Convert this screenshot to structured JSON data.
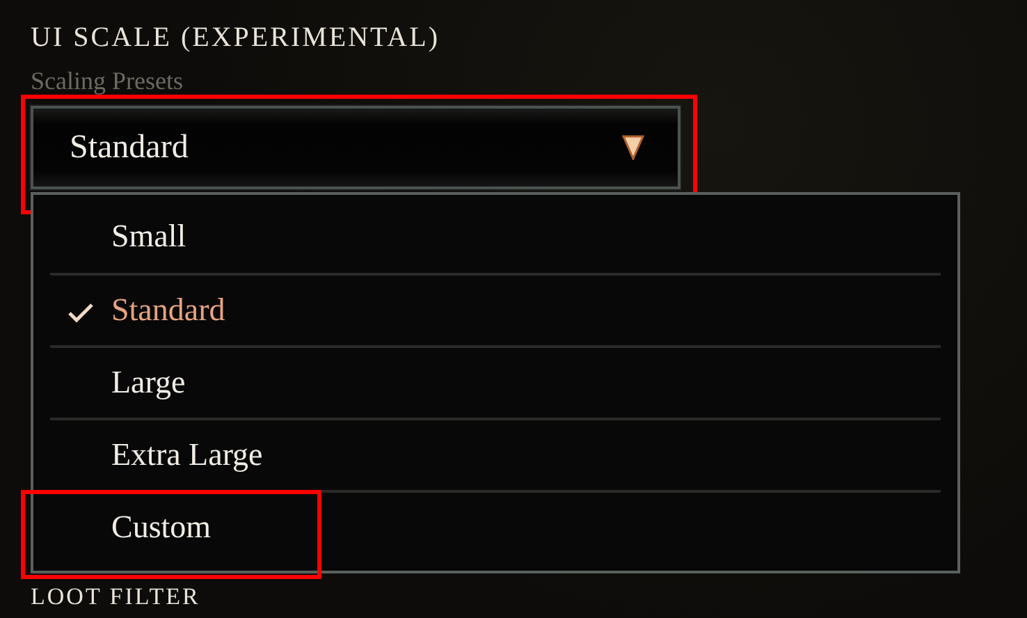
{
  "section": {
    "title": "UI SCALE (EXPERIMENTAL)",
    "subtitle": "Scaling Presets"
  },
  "dropdown": {
    "value": "Standard",
    "expanded": true,
    "highlighted": true,
    "options": [
      {
        "label": "Small",
        "selected": false,
        "highlighted": false
      },
      {
        "label": "Standard",
        "selected": true,
        "highlighted": false
      },
      {
        "label": "Large",
        "selected": false,
        "highlighted": false
      },
      {
        "label": "Extra Large",
        "selected": false,
        "highlighted": false
      },
      {
        "label": "Custom",
        "selected": false,
        "highlighted": true
      }
    ]
  },
  "next_section": {
    "title": "LOOT FILTER"
  }
}
